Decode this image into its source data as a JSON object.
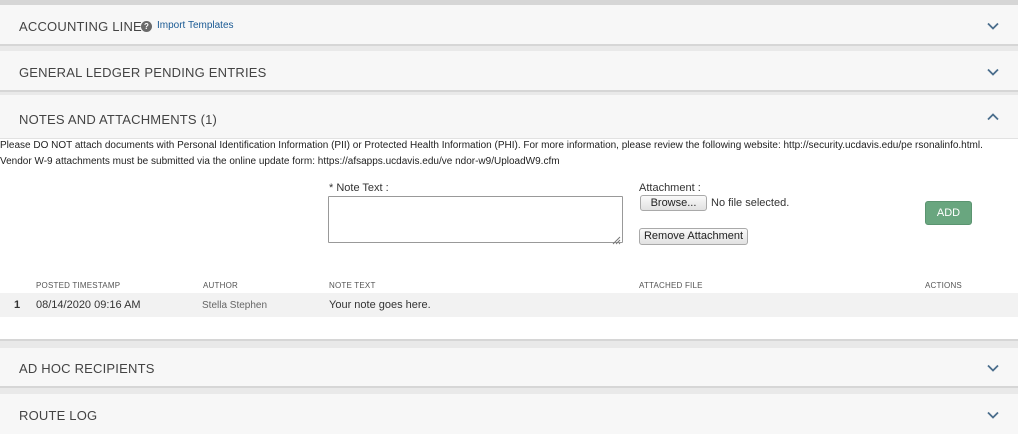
{
  "panels": {
    "accounting": {
      "title": "ACCOUNTING LINES",
      "help": "?",
      "link": "Import Templates"
    },
    "gl": {
      "title": "GENERAL LEDGER PENDING ENTRIES"
    },
    "notes": {
      "title": "NOTES AND ATTACHMENTS (1)"
    },
    "adhoc": {
      "title": "AD HOC RECIPIENTS"
    },
    "route": {
      "title": "ROUTE LOG"
    }
  },
  "notes": {
    "notice_line1": "Please DO NOT attach documents with Personal Identification Information (PII) or Protected Health Information (PHI). For more information, please review the following website: http://security.ucdavis.edu/pe rsonalinfo.html.",
    "notice_line2": "Vendor W-9 attachments must be submitted via the online update form: https://afsapps.ucdavis.edu/ve ndor-w9/UploadW9.cfm",
    "note_text_label": "* Note Text :",
    "note_text_value": "",
    "attachment_label": "Attachment :",
    "browse_label": "Browse...",
    "no_file_text": "No file selected.",
    "remove_attachment_label": "Remove Attachment",
    "add_label": "ADD",
    "table": {
      "headers": [
        "POSTED TIMESTAMP",
        "AUTHOR",
        "NOTE TEXT",
        "ATTACHED FILE",
        "ACTIONS"
      ],
      "rows": [
        {
          "index": "1",
          "timestamp": "08/14/2020 09:16 AM",
          "author": "Stella Stephen",
          "note": "Your note goes here.",
          "file": "",
          "actions": ""
        }
      ]
    }
  },
  "icons": {
    "collapse": "chevron-down-icon",
    "expand": "chevron-up-icon",
    "help": "question-icon"
  },
  "colors": {
    "accent_green": "#69a67f",
    "link_blue": "#1a5a94"
  }
}
